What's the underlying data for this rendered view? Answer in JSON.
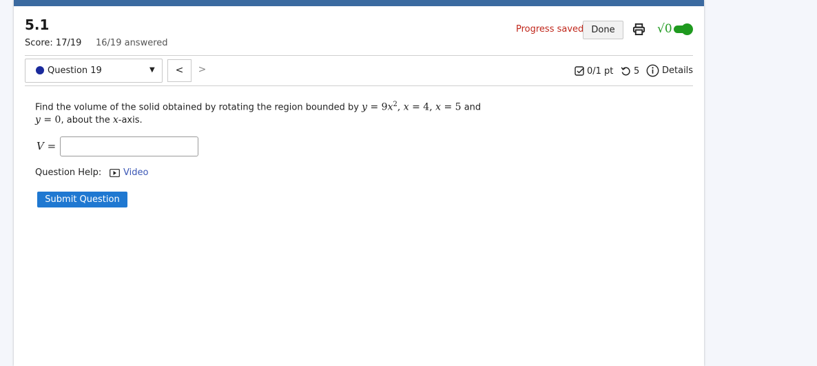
{
  "header": {
    "assignment_title": "5.1",
    "score": "Score: 17/19",
    "answered": "16/19 answered",
    "progress_status": "Progress saved",
    "done_label": "Done",
    "math_toggle_symbol": "√0"
  },
  "question_nav": {
    "current": "Question 19",
    "prev_symbol": "<",
    "next_symbol": ">"
  },
  "meta": {
    "points": "0/1 pt",
    "retries": "5",
    "details_label": "Details"
  },
  "problem": {
    "text_1": "Find the volume of the solid obtained by rotating the region bounded by ",
    "eq_1_lhs": "y",
    "eq_1_rhs": " = 9",
    "eq_1_var": "x",
    "eq_1_exp": "2",
    "sep_1": ", ",
    "eq_2_var": "x",
    "eq_2_rhs": " = 4",
    "sep_2": ", ",
    "eq_3_var": "x",
    "eq_3_rhs": " = 5",
    "text_2": " and",
    "eq_4_var": "y",
    "eq_4_rhs": " = 0",
    "text_3": ", about the ",
    "axis_var": "x",
    "text_4": "-axis."
  },
  "answer": {
    "label_var": "V",
    "label_eq": " =",
    "value": ""
  },
  "help": {
    "label": "Question Help:",
    "video_label": "Video"
  },
  "submit_label": "Submit Question",
  "colors": {
    "accent": "#3b6aa0",
    "submit": "#1f78d1",
    "saved": "#c0261a",
    "toggle": "#1f9a1f"
  }
}
